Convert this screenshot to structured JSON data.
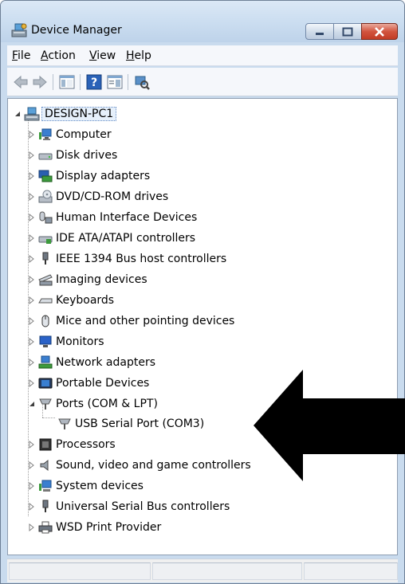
{
  "window": {
    "title": "Device Manager"
  },
  "menu": [
    {
      "label": "File",
      "u": "F",
      "rest": "ile"
    },
    {
      "label": "Action",
      "u": "A",
      "rest": "ction"
    },
    {
      "label": "View",
      "u": "V",
      "rest": "iew"
    },
    {
      "label": "Help",
      "u": "H",
      "rest": "elp"
    }
  ],
  "tree": {
    "root": "DESIGN-PC1",
    "items": [
      {
        "label": "Computer",
        "icon": "computer-icon"
      },
      {
        "label": "Disk drives",
        "icon": "disk-drive-icon"
      },
      {
        "label": "Display adapters",
        "icon": "display-adapter-icon"
      },
      {
        "label": "DVD/CD-ROM drives",
        "icon": "dvd-drive-icon"
      },
      {
        "label": "Human Interface Devices",
        "icon": "hid-icon"
      },
      {
        "label": "IDE ATA/ATAPI controllers",
        "icon": "ide-controller-icon"
      },
      {
        "label": "IEEE 1394 Bus host controllers",
        "icon": "ieee1394-icon"
      },
      {
        "label": "Imaging devices",
        "icon": "imaging-device-icon"
      },
      {
        "label": "Keyboards",
        "icon": "keyboard-icon"
      },
      {
        "label": "Mice and other pointing devices",
        "icon": "mouse-icon"
      },
      {
        "label": "Monitors",
        "icon": "monitor-icon"
      },
      {
        "label": "Network adapters",
        "icon": "network-adapter-icon"
      },
      {
        "label": "Portable Devices",
        "icon": "portable-device-icon"
      },
      {
        "label": "Ports (COM & LPT)",
        "icon": "port-icon",
        "expanded": true
      },
      {
        "label": "USB Serial Port (COM3)",
        "icon": "port-icon",
        "child": true
      },
      {
        "label": "Processors",
        "icon": "processor-icon"
      },
      {
        "label": "Sound, video and game controllers",
        "icon": "sound-icon"
      },
      {
        "label": "System devices",
        "icon": "system-device-icon"
      },
      {
        "label": "Universal Serial Bus controllers",
        "icon": "usb-icon"
      },
      {
        "label": "WSD Print Provider",
        "icon": "printer-icon"
      }
    ]
  },
  "colors": {
    "titlebar": "#cddff1",
    "selection": "#e6f0fb",
    "arrow": "#000000",
    "close_button": "#c23c25"
  }
}
